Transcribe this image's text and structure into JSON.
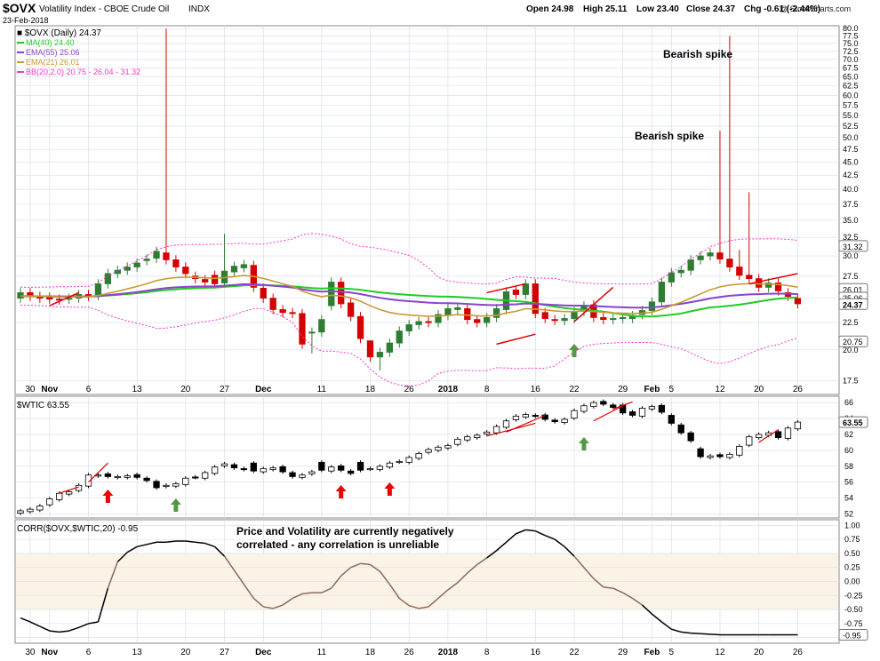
{
  "header": {
    "symbol": "$OVX",
    "name": "Volatility Index - CBOE Crude Oil",
    "exchange": "INDX",
    "date": "23-Feb-2018",
    "watermark": "@ StockCharts.com",
    "ohlc": [
      {
        "label": "Open",
        "value": "24.98"
      },
      {
        "label": "High",
        "value": "25.11"
      },
      {
        "label": "Low",
        "value": "23.40"
      },
      {
        "label": "Close",
        "value": "24.37"
      },
      {
        "label": "Chg",
        "value": "-0.61 (-2.44%)"
      }
    ]
  },
  "colors": {
    "up": "#2e7d32",
    "down": "#d50000",
    "ma40": "#22cc22",
    "ema55": "#8844cc",
    "ema21": "#cc9933",
    "bb": "#ff33cc",
    "corr": "#000000",
    "corr_low": "#8b6a5a",
    "band": "#faf3e6",
    "grid": "#d8dde8",
    "arrow_red": "#ee0000",
    "arrow_green": "#559944"
  },
  "chart_data": [
    {
      "type": "candlestick",
      "title": "$OVX Volatility Index - CBOE Crude Oil INDX",
      "legend": [
        {
          "label": "$OVX (Daily) 24.37",
          "color": "#000000"
        },
        {
          "label": "MA(40) 24.40",
          "color": "#22cc22"
        },
        {
          "label": "EMA(55) 25.06",
          "color": "#8844cc"
        },
        {
          "label": "EMA(21) 26.01",
          "color": "#cc9933"
        },
        {
          "label": "BB(20,2.0) 20.75 - 26.04 - 31.32",
          "color": "#ff33cc"
        }
      ],
      "legend_position": "top-left",
      "ylim": [
        16.5,
        81
      ],
      "yscale": "log",
      "yticks": [
        17.5,
        20.0,
        22.5,
        25.0,
        27.5,
        30.0,
        32.5,
        35.0,
        37.5,
        40.0,
        42.5,
        45.0,
        47.5,
        50.0,
        52.5,
        55.0,
        57.5,
        60.0,
        62.5,
        65.0,
        67.5,
        70.0,
        72.5,
        75.0,
        77.5,
        80.0
      ],
      "ytick_labels": [
        "17.5",
        "20.0",
        "22.5",
        "25.0",
        "27.5",
        "30.0",
        "32.5",
        "35.0",
        "37.5",
        "40.0",
        "42.5",
        "45.0",
        "47.5",
        "50.0",
        "52.5",
        "55.0",
        "57.5",
        "60.0",
        "62.5",
        "65.0",
        "67.5",
        "70.0",
        "72.5",
        "75.0",
        "77.5",
        "80.0"
      ],
      "price_flags": [
        {
          "value": "31.32",
          "y": 31.32
        },
        {
          "value": "26.01",
          "y": 26.01
        },
        {
          "value": "25.06",
          "y": 25.06
        },
        {
          "value": "24.37",
          "y": 24.37
        },
        {
          "value": "20.75",
          "y": 20.75
        }
      ],
      "annotations": [
        {
          "text": "Bearish spike",
          "index": 85
        },
        {
          "text": "Bearish spike",
          "index": 81
        }
      ]
    },
    {
      "type": "candlestick",
      "title": "$WTIC 63.55",
      "ylim": [
        51.5,
        66.8
      ],
      "yticks": [
        52,
        54,
        56,
        58,
        60,
        62,
        64,
        66
      ],
      "ytick_labels": [
        "52",
        "54",
        "56",
        "58",
        "60",
        "62",
        "64",
        "66"
      ],
      "last_flag": {
        "value": "63.55",
        "y": 63.55
      }
    },
    {
      "type": "line",
      "title": "CORR($OVX,$WTIC,20) -0.95",
      "ylim": [
        -1.1,
        1.1
      ],
      "yticks": [
        1.0,
        0.75,
        0.5,
        0.25,
        0.0,
        -0.25,
        -0.5,
        -0.75,
        -1.0
      ],
      "ytick_labels": [
        "1.00",
        "0.75",
        "0.50",
        "0.25",
        "0.00",
        "-0.25",
        "-0.50",
        "-0.75",
        "-1.00"
      ],
      "band": [
        -0.5,
        0.5
      ],
      "last_flag": {
        "value": "-0.95",
        "y": -0.95
      },
      "note": [
        "Price and Volatility are currently negatively",
        "correlated - any correlation is unreliable"
      ]
    }
  ],
  "xaxis": {
    "labels": [
      {
        "text": "30",
        "index": 1,
        "bold": false
      },
      {
        "text": "Nov",
        "index": 3,
        "bold": true
      },
      {
        "text": "6",
        "index": 7,
        "bold": false
      },
      {
        "text": "13",
        "index": 12,
        "bold": false
      },
      {
        "text": "20",
        "index": 17,
        "bold": false
      },
      {
        "text": "27",
        "index": 21,
        "bold": false
      },
      {
        "text": "Dec",
        "index": 25,
        "bold": true
      },
      {
        "text": "11",
        "index": 31,
        "bold": false
      },
      {
        "text": "18",
        "index": 36,
        "bold": false
      },
      {
        "text": "26",
        "index": 40,
        "bold": false
      },
      {
        "text": "2018",
        "index": 44,
        "bold": true
      },
      {
        "text": "8",
        "index": 48,
        "bold": false
      },
      {
        "text": "16",
        "index": 53,
        "bold": false
      },
      {
        "text": "22",
        "index": 57,
        "bold": false
      },
      {
        "text": "29",
        "index": 62,
        "bold": false
      },
      {
        "text": "Feb",
        "index": 65,
        "bold": true
      },
      {
        "text": "5",
        "index": 67,
        "bold": false
      },
      {
        "text": "12",
        "index": 72,
        "bold": false
      },
      {
        "text": "20",
        "index": 76,
        "bold": false
      },
      {
        "text": "26",
        "index": 80,
        "bold": false
      }
    ]
  }
}
